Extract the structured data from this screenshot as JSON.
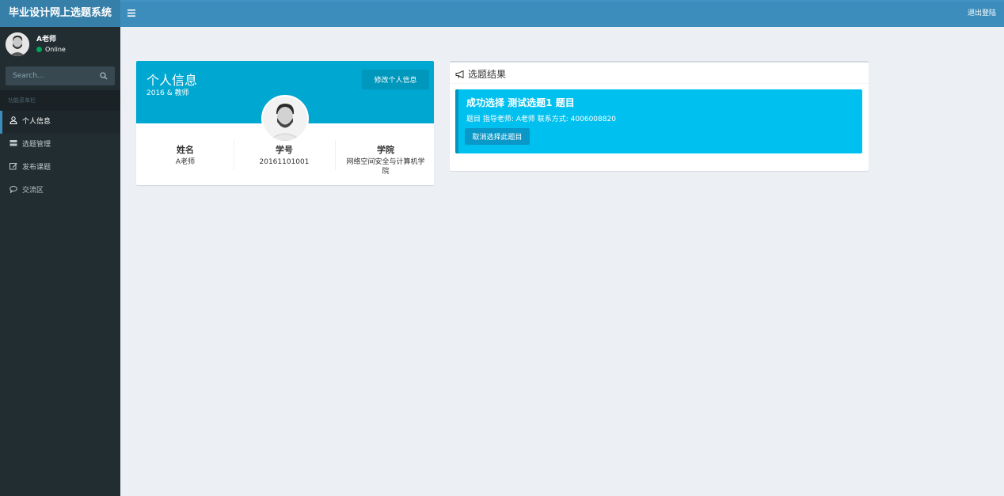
{
  "app": {
    "title": "毕业设计网上选题系统"
  },
  "header": {
    "menu_toggle_icon": "hamburger-icon",
    "logout_label": "退出登陆"
  },
  "user": {
    "name": "A老师",
    "status": "Online",
    "status_color": "#00a65a"
  },
  "sidebar": {
    "search_placeholder": "Search...",
    "menu_header": "功能菜单栏",
    "items": [
      {
        "label": "个人信息",
        "icon": "user-icon",
        "active": true
      },
      {
        "label": "选题管理",
        "icon": "server-icon",
        "active": false
      },
      {
        "label": "发布课题",
        "icon": "edit-icon",
        "active": false
      },
      {
        "label": "交流区",
        "icon": "comment-icon",
        "active": false
      }
    ]
  },
  "profile": {
    "title": "个人信息",
    "subtitle": "2016 & 教师",
    "edit_button": "修改个人信息",
    "stats": [
      {
        "label": "姓名",
        "value": "A老师"
      },
      {
        "label": "学号",
        "value": "20161101001"
      },
      {
        "label": "学院",
        "value": "网络空间安全与计算机学院"
      }
    ]
  },
  "result": {
    "title": "选题结果",
    "icon": "bullhorn-icon",
    "callout_title": "成功选择 测试选题1 题目",
    "callout_text": "题目 指导老师: A老师 联系方式: 4006008820",
    "cancel_button": "取消选择此题目"
  },
  "colors": {
    "header": "#3c8dbc",
    "logo": "#367fa9",
    "sidebar": "#222d32",
    "profile_top": "#00a7d0",
    "callout": "#00c0ef"
  }
}
